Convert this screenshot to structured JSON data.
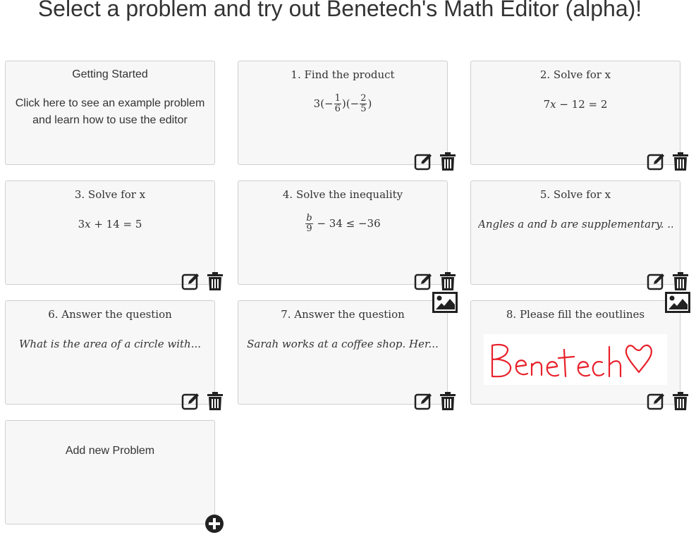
{
  "header": {
    "title": "Select a problem and try out Benetech's Math Editor (alpha)!"
  },
  "intro_card": {
    "title": "Getting Started",
    "description": "Click here to see an example problem and learn how to use the editor"
  },
  "problems": [
    {
      "title": "1. Find the product",
      "expression": "3(−1/6)(−2/5)",
      "has_image": false
    },
    {
      "title": "2. Solve for x",
      "expression": "7x − 12 = 2",
      "has_image": false
    },
    {
      "title": "3. Solve for x",
      "expression": "3x + 14 = 5",
      "has_image": false
    },
    {
      "title": "4. Solve the inequality",
      "expression": "b/9 − 34 ≤ −36",
      "has_image": false
    },
    {
      "title": "5. Solve for x",
      "expression": "Angles a and b are supplementary. ...",
      "has_image": false
    },
    {
      "title": "6. Answer the question",
      "expression": "What is the area of a circle with...",
      "has_image": false
    },
    {
      "title": "7. Answer the question",
      "expression": "Sarah works at a coffee shop. Her...",
      "has_image": true
    },
    {
      "title": "8. Please fill the eoutlines",
      "expression": "",
      "has_image": true,
      "image_text": "Benetech♡"
    }
  ],
  "add_card": {
    "label": "Add new Problem"
  },
  "icons": {
    "edit": "edit-icon",
    "delete": "trash-icon",
    "image": "image-icon",
    "add": "plus-circle-icon"
  },
  "colors": {
    "card_bg": "#f7f7f7",
    "card_border": "#cfcfcf",
    "icon": "#222222",
    "drawing": "#e8202a"
  }
}
